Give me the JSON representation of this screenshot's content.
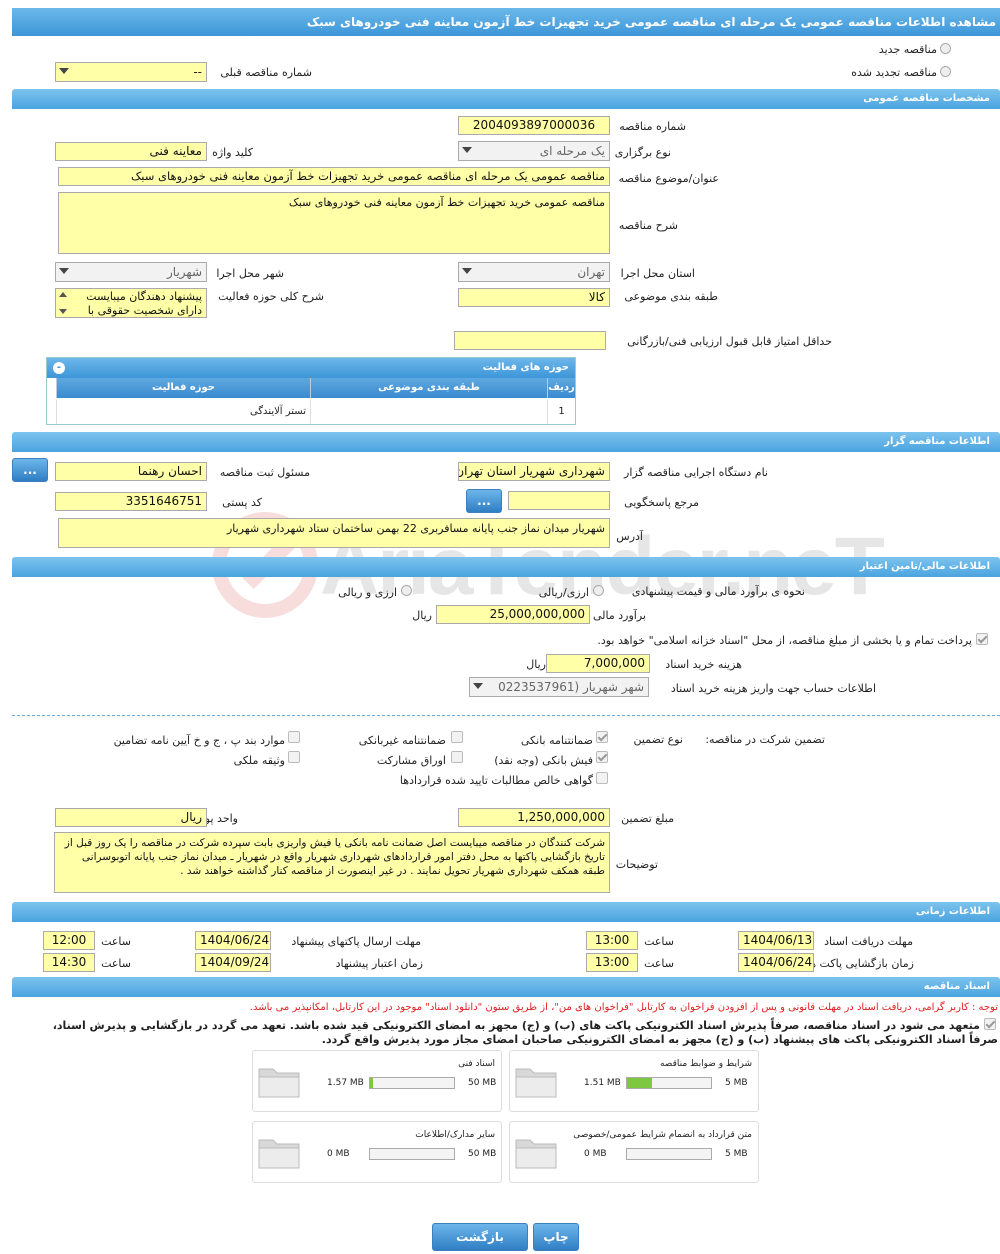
{
  "page_title": "مشاهده اطلاعات مناقصه عمومی یک مرحله ای مناقصه عمومی خرید تجهیزات خط آزمون معاینه فنی خودروهای سبک",
  "top": {
    "new_label": "مناقصه جدید",
    "renewed_label": "مناقصه تجدید شده",
    "prev_label": "شماره مناقصه قبلی",
    "prev_value": "--"
  },
  "sections": {
    "general": "مشخصات مناقصه عمومی",
    "organizer": "اطلاعات مناقصه گزار",
    "finance": "اطلاعات مالی/تامین اعتبار",
    "timing": "اطلاعات زمانی",
    "docs": "اسناد مناقصه"
  },
  "general": {
    "tender_no_label": "شماره مناقصه",
    "tender_no": "2004093897000036",
    "holding_label": "نوع برگزاری",
    "holding": "یک مرحله ای",
    "keyword_label": "کلید واژه",
    "keyword": "معاینه فنی",
    "subject_label": "عنوان/موضوع مناقصه",
    "subject": "مناقصه عمومی یک مرحله ای مناقصه عمومی خرید تجهیزات خط آزمون معاینه فنی خودروهای سبک",
    "desc_label": "شرح مناقصه",
    "desc": "مناقصه عمومی خرید تجهیزات خط آزمون معاینه فنی خودروهای سبک",
    "province_label": "استان محل اجرا",
    "province": "تهران",
    "city_label": "شهر محل اجرا",
    "city": "شهریار",
    "category_label": "طبقه بندی موضوعی",
    "category": "کالا",
    "activity_desc_label": "شرح کلی حوزه فعالیت",
    "activity_desc": "پیشنهاد دهندگان میبایست دارای شخصیت حقوقی با",
    "min_score_label": "حداقل امتیاز قابل قبول ارزیابی فنی/بازرگانی",
    "min_score": ""
  },
  "activity_grid": {
    "title": "حوزه های فعالیت",
    "col_row": "ردیف",
    "col_cat": "طبقه بندی موضوعی",
    "col_area": "حوزه فعالیت",
    "rows": [
      {
        "row": "1",
        "cat": "",
        "area": "تستر آلایندگی"
      }
    ]
  },
  "organizer": {
    "org_label": "نام دستگاه اجرایی مناقصه گزار",
    "org": "شهرداری شهریار استان تهران",
    "registrar_label": "مسئول ثبت مناقصه",
    "registrar": "احسان رهنما",
    "ref_label": "مرجع پاسخگویی",
    "ref": "",
    "postal_label": "کد پستی",
    "postal": "3351646751",
    "address_label": "آدرس",
    "address": "شهریار میدان نماز  جنب پایانه مسافربری  22 بهمن ساختمان ستاد شهرداری شهریار",
    "more_btn": "...",
    "more_btn2": "..."
  },
  "finance": {
    "method_label": "نحوه ی برآورد مالی و قیمت پیشنهادی",
    "opt_rial": "ارزی/ریالی",
    "opt_fx": "ارزی و ریالی",
    "estimate_label": "برآورد مالی",
    "estimate": "25,000,000,000",
    "estimate_unit": "ریال",
    "islamic_text": "پرداخت تمام و یا بخشی از مبلغ مناقصه، از محل \"اسناد خزانه اسلامی\" خواهد بود.",
    "doc_cost_label": "هزینه خرید اسناد",
    "doc_cost": "7,000,000",
    "doc_cost_unit": "ریال",
    "account_label": "اطلاعات حساب جهت واریز هزینه خرید اسناد",
    "account": "شهر شهریار (0223537961"
  },
  "guarantee": {
    "title": "تضمین شرکت در مناقصه:",
    "type_label": "نوع تضمین",
    "bank": "ضمانتنامه بانکی",
    "nonbank": "ضمانتنامه غیربانکی",
    "clauses": "موارد بند پ ، ج و خ آیین نامه تضامین",
    "cash": "فیش بانکی (وجه نقد)",
    "bonds": "اوراق مشارکت",
    "property": "وثیقه ملکی",
    "claims": "گواهی خالص مطالبات تایید شده قراردادها",
    "amount_label": "مبلغ تضمین",
    "amount": "1,250,000,000",
    "currency_label": "واحد پول",
    "currency": "ریال",
    "notes_label": "توضیحات",
    "notes": "شرکت کنندگان در مناقصه میبایست اصل ضمانت نامه بانکی یا فیش واریزی بابت سپرده شرکت در مناقصه را یک روز قبل از تاریخ بازگشایی پاکتها به محل دفتر امور قراردادهای شهرداری شهریار واقع در شهریار ـ میدان نماز جنب پایانه اتوبوسرانی طبقه همکف شهرداری شهریار تحویل نمایند . در غیر اینصورت از مناقصه کنار گذاشته خواهند شد ."
  },
  "timing": {
    "doc_deadline_label": "مهلت دریافت اسناد",
    "doc_deadline": "1404/06/13",
    "time_label": "ساعت",
    "doc_time": "13:00",
    "send_deadline_label": "مهلت ارسال پاکتهای پیشنهاد",
    "send_deadline": "1404/06/24",
    "send_time": "12:00",
    "open_label": "زمان بازگشایی پاکت ها",
    "open_date": "1404/06/24",
    "open_time": "13:00",
    "valid_label": "زمان اعتبار پیشنهاد",
    "valid_date": "1404/09/24",
    "valid_time": "14:30"
  },
  "docs": {
    "notice": "توجه : کاربر گرامی، دریافت اسناد در مهلت قانونی و پس از افزودن فراخوان به کارتابل \"فراخوان های من\"، از طریق ستون \"دانلود اسناد\" موجود در این کارتابل، امکانپذیر می باشد.",
    "commit1": "متعهد می شود در اسناد مناقصه، صرفاً پذیرش اسناد الکترونیکی پاکت های (ب) و (ج) مجهز به امضای الکترونیکی قید شده باشد. تعهد می گردد در بازگشایی و پذیرش اسناد،",
    "commit2": "صرفاً اسناد الکترونیکی پاکت های پیشنهاد (ب) و (ج) مجهز به امضای الکترونیکی صاحبان امضای مجاز مورد پذیرش واقع گردد.",
    "files": [
      {
        "name": "شرایط و ضوابط مناقصه",
        "size": "1.51 MB",
        "max": "5 MB",
        "fill": 0.3
      },
      {
        "name": "اسناد فنی",
        "size": "1.57 MB",
        "max": "50 MB",
        "fill": 0.03
      },
      {
        "name": "متن قرارداد به انضمام شرایط عمومی/خصوصی",
        "size": "0 MB",
        "max": "5 MB",
        "fill": 0
      },
      {
        "name": "سایر مدارک/اطلاعات",
        "size": "0 MB",
        "max": "50 MB",
        "fill": 0
      }
    ]
  },
  "buttons": {
    "print": "چاپ",
    "back": "بازگشت"
  },
  "watermark": "AriaTender.neT"
}
